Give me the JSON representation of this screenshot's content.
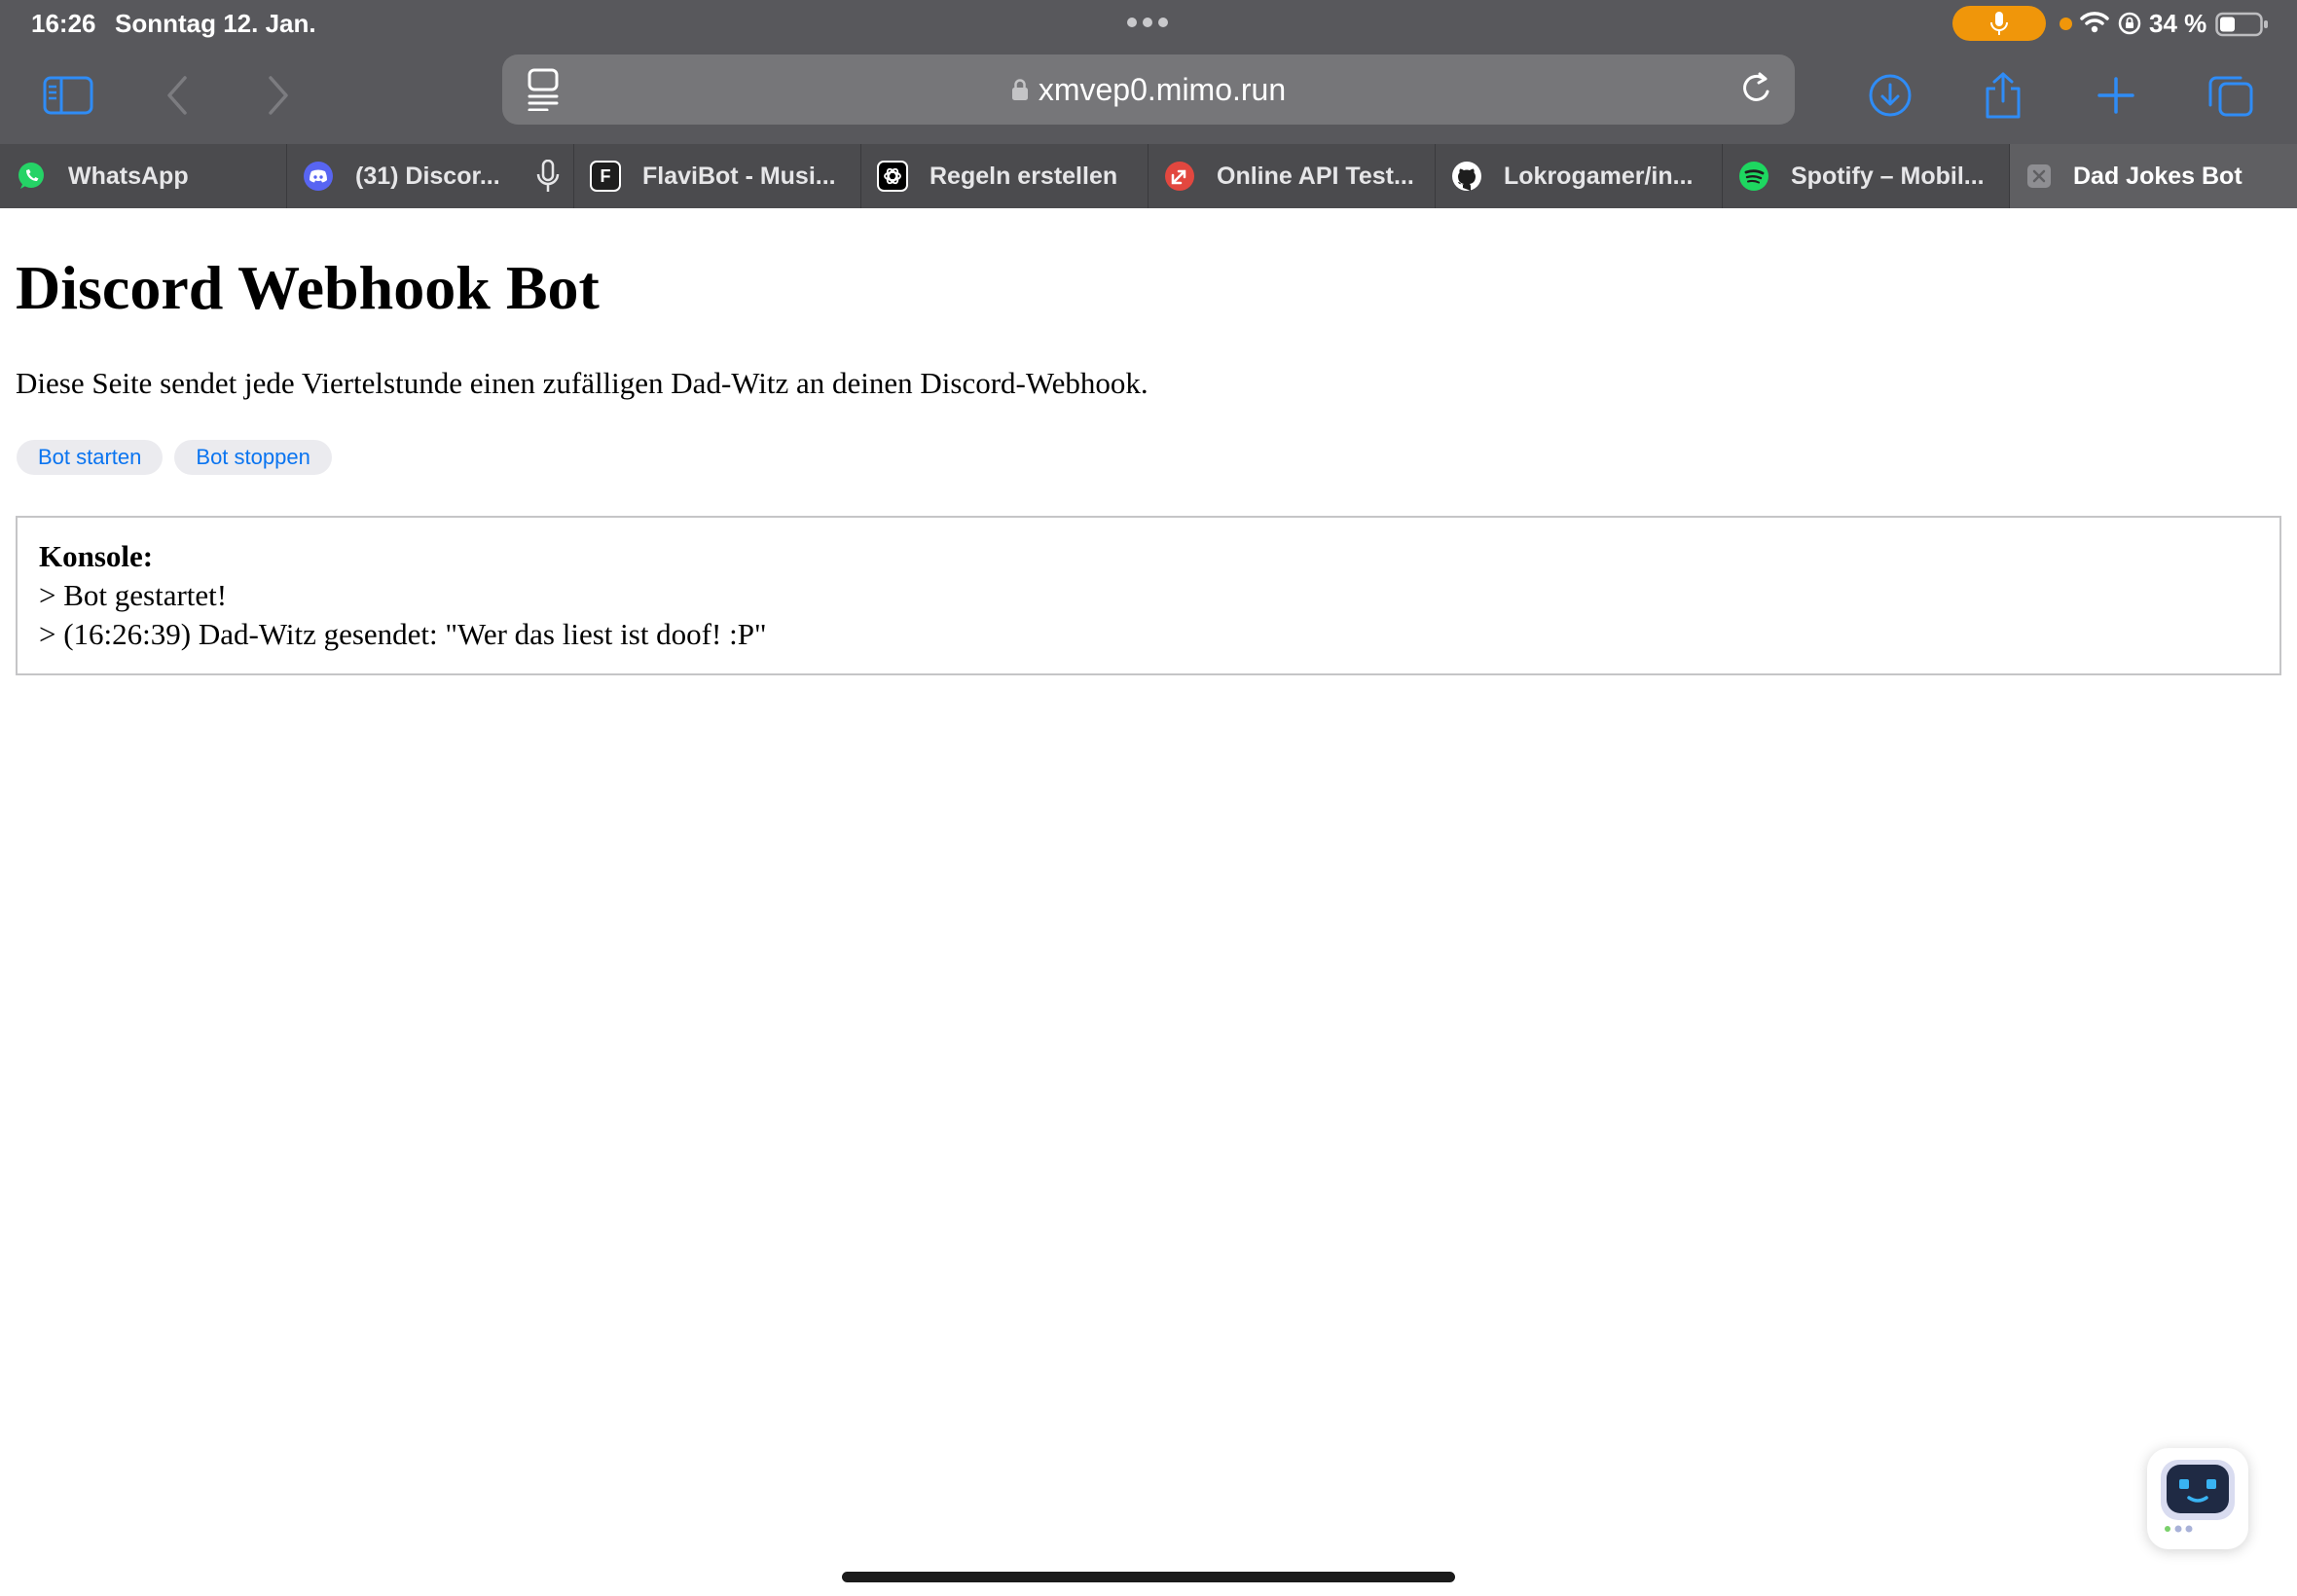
{
  "status_bar": {
    "time": "16:26",
    "date": "Sonntag 12. Jan.",
    "battery": "34 %",
    "mic_active_color": "#f0960a"
  },
  "toolbar": {
    "url": "xmvep0.mimo.run",
    "icons": [
      "sidebar-icon",
      "back-icon",
      "forward-icon",
      "reader-icon",
      "lock-icon",
      "reload-icon",
      "download-icon",
      "share-icon",
      "new-tab-icon",
      "tabs-overview-icon"
    ],
    "accent_color": "#2f8cf6"
  },
  "tabs": [
    {
      "label": "WhatsApp",
      "icon": "whatsapp-icon"
    },
    {
      "label": "(31) Discor...",
      "icon": "discord-icon"
    },
    {
      "label": "FlaviBot - Musi...",
      "icon": "flavibot-icon"
    },
    {
      "label": "Regeln erstellen",
      "icon": "openai-icon"
    },
    {
      "label": "Online API Test...",
      "icon": "api-tester-icon"
    },
    {
      "label": "Lokrogamer/in...",
      "icon": "github-icon"
    },
    {
      "label": "Spotify – Mobil...",
      "icon": "spotify-icon"
    },
    {
      "label": "Dad Jokes Bot",
      "icon": "close-tab-icon",
      "active": true
    }
  ],
  "page": {
    "title": "Discord Webhook Bot",
    "description": "Diese Seite sendet jede Viertelstunde einen zufälligen Dad-Witz an deinen Discord-Webhook.",
    "buttons": {
      "start": "Bot starten",
      "stop": "Bot stoppen"
    },
    "console": {
      "title": "Konsole:",
      "lines": [
        "> Bot gestartet!",
        "> (16:26:39) Dad-Witz gesendet: \"Wer das liest ist doof! :P\""
      ]
    }
  }
}
